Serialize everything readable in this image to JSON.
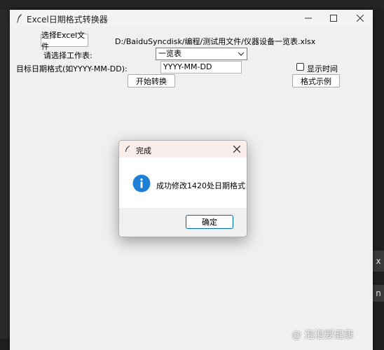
{
  "window": {
    "title": "Excel日期格式转换器"
  },
  "form": {
    "select_file_button": "选择Excel文件",
    "file_path": "D:/BaiduSyncdisk/编程/测试用文件/仪器设备一览表.xlsx",
    "sheet_label": "请选择工作表:",
    "sheet_value": "一览表",
    "date_format_label": "目标日期格式(如YYYY-MM-DD):",
    "date_format_value": "YYYY-MM-DD",
    "show_time_label": "显示时间",
    "show_time_checked": false,
    "start_button": "开始转换",
    "example_button": "格式示例"
  },
  "dialog": {
    "title": "完成",
    "message": "成功修改1420处日期格式",
    "ok_button": "确定"
  },
  "background": {
    "right_glyph_1": "x",
    "right_glyph_2": "n"
  },
  "watermark": {
    "text": "@ 泡泡要健康"
  },
  "colors": {
    "accent": "#0067c0",
    "info_icon": "#1e7fd6",
    "dialog_title_bg": "#f9eeec"
  }
}
